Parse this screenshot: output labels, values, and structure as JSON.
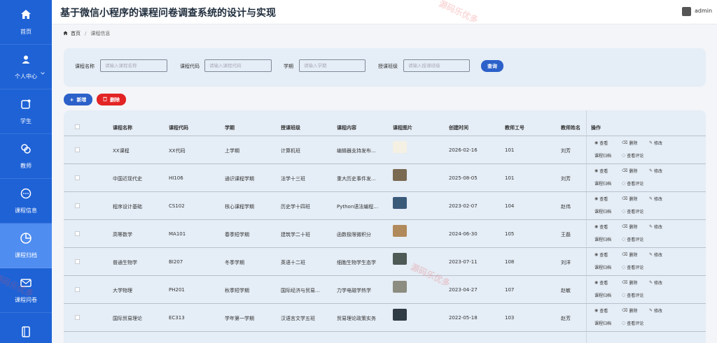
{
  "app": {
    "title": "基于微信小程序的课程问卷调查系统的设计与实现",
    "user": "admin"
  },
  "sidebar": {
    "items": [
      {
        "label": "首页",
        "icon": "home-icon"
      },
      {
        "label": "个人中心",
        "icon": "person-icon"
      },
      {
        "label": "学生",
        "icon": "student-icon"
      },
      {
        "label": "教师",
        "icon": "teacher-icon"
      },
      {
        "label": "课程信息",
        "icon": "chat-icon"
      },
      {
        "label": "课程归档",
        "icon": "pie-chart-icon"
      },
      {
        "label": "课程问卷",
        "icon": "mail-icon"
      },
      {
        "label": "",
        "icon": "notebook-icon"
      }
    ],
    "active_index": 5
  },
  "breadcrumb": {
    "home": "首页",
    "current": "课程信息"
  },
  "search": {
    "fields": [
      {
        "label": "课程名称",
        "placeholder": "请输入课程名称"
      },
      {
        "label": "课程代码",
        "placeholder": "请输入课程代码"
      },
      {
        "label": "学期",
        "placeholder": "请输入学期"
      },
      {
        "label": "授课班级",
        "placeholder": "请输入授课班级"
      }
    ],
    "button": "查询"
  },
  "actions": {
    "add": "新增",
    "delete": "删除"
  },
  "table": {
    "columns": [
      "课程名称",
      "课程代码",
      "学期",
      "授课班级",
      "课程内容",
      "课程图片",
      "创建时间",
      "教师工号",
      "教师姓名",
      "操作"
    ],
    "ops": {
      "view": "查看",
      "delete": "删除",
      "edit": "修改",
      "archive": "课程归档",
      "comments": "查看评论"
    },
    "rows": [
      {
        "name": "XX课程",
        "code": "XX代码",
        "term": "上学期",
        "class": "计算机班",
        "content": "编辑器支持发布…",
        "created": "2026-02-16",
        "tno": "101",
        "tname": "刘芳",
        "img": "#f4f1e4"
      },
      {
        "name": "中国近现代史",
        "code": "HI106",
        "term": "通识课程学期",
        "class": "法学十三班",
        "content": "重大历史事件发…",
        "created": "2025-08-05",
        "tno": "101",
        "tname": "刘芳",
        "img": "#7a6a52"
      },
      {
        "name": "程序设计基础",
        "code": "CS102",
        "term": "核心课程学期",
        "class": "历史学十四班",
        "content": "Python语法编程…",
        "created": "2023-02-07",
        "tno": "104",
        "tname": "赵伟",
        "img": "#3a5a7a"
      },
      {
        "name": "高等数学",
        "code": "MA101",
        "term": "春季短学期",
        "class": "建筑学二十班",
        "content": "函数极限微积分",
        "created": "2024-06-30",
        "tno": "105",
        "tname": "王磊",
        "img": "#b08a5a"
      },
      {
        "name": "普通生物学",
        "code": "BI207",
        "term": "冬季学期",
        "class": "英语十二班",
        "content": "细胞生物学生态学",
        "created": "2023-07-11",
        "tno": "108",
        "tname": "刘洋",
        "img": "#4d5a55"
      },
      {
        "name": "大学物理",
        "code": "PH201",
        "term": "秋季短学期",
        "class": "国际经济与贸易…",
        "content": "力学电磁学热学",
        "created": "2023-04-27",
        "tno": "107",
        "tname": "赵敏",
        "img": "#8c8c80"
      },
      {
        "name": "国际贸易理论",
        "code": "EC313",
        "term": "学年第一学期",
        "class": "汉语言文学五班",
        "content": "贸易理论政策实务",
        "created": "2022-05-18",
        "tno": "103",
        "tname": "赵芳",
        "img": "#2f3b45"
      }
    ]
  },
  "watermark": "源码乐优多"
}
